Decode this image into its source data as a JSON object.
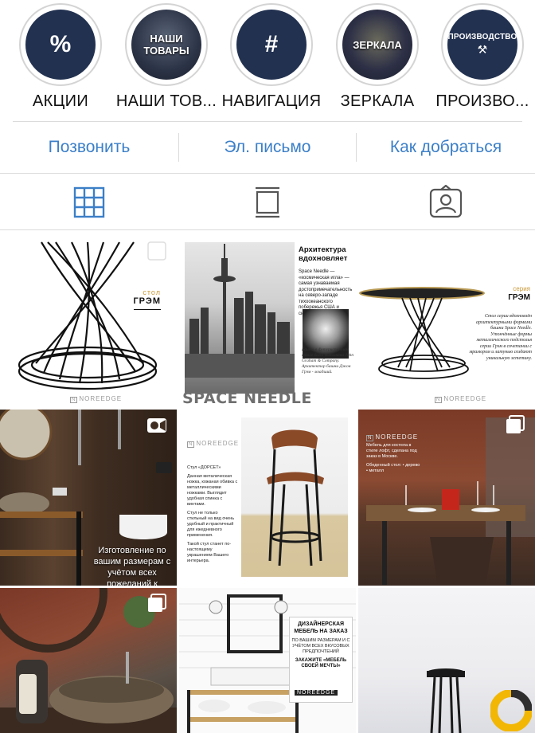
{
  "highlights": [
    {
      "label": "АКЦИИ",
      "symbol": "%"
    },
    {
      "label": "НАШИ ТОВ...",
      "cover_line1": "НАШИ",
      "cover_line2": "ТОВАРЫ"
    },
    {
      "label": "НАВИГАЦИЯ",
      "symbol": "#"
    },
    {
      "label": "ЗЕРКАЛА",
      "cover_text": "ЗЕРКАЛА"
    },
    {
      "label": "ПРОИЗВО...",
      "cover_text": "ПРОИЗВОДСТВО",
      "cover_icon": "hammer-crossed-icon"
    }
  ],
  "actions": {
    "call": "Позвонить",
    "email": "Эл. письмо",
    "directions": "Как добраться"
  },
  "tabs": {
    "grid_icon": "grid-icon",
    "feed_icon": "list-feed-icon",
    "tagged_icon": "tagged-person-icon",
    "active": "grid",
    "active_color": "#3b7fc8"
  },
  "posts": {
    "p1": {
      "small": "стол",
      "big": "ГРЭМ",
      "brand": "NOREEDGE",
      "multi": true
    },
    "p2": {
      "title": "SPACE NEEDLE",
      "heading_line1": "Архитектура",
      "heading_line2": "вдохновляет",
      "body": "Space Needle — «космическая игла» — самая узнаваемая достопримечательность на северо-западе тихоокеанского побережья США и символ города Сиэтл.",
      "caption": "Башня в футуристичном стиле была выполнена John Graham & Company. Архитектор башни Джон Грэм - младший."
    },
    "p3": {
      "small": "серия",
      "big": "ГРЭМ",
      "body": "Стол серии вдохновлён архитектурными формами башни Space Needle. Утончённые формы металлического подстолья серии Грэм в сочетании с мрамором и латунью создают уникальную эстетику.",
      "brand": "NOREEDGE"
    },
    "p4": {
      "caption": "Изготовление по вашим размерам с учётом всех пожеланий к материалам и дизайну",
      "video": true
    },
    "p5": {
      "brand": "NOREEDGE",
      "text1": "Стул «ДОРСЕТ»",
      "text2": "Данная металическая ножка, кожаная обивка с металлическими ножками. Выглядит удобная спинка с винтами.",
      "text3": "Стул не только стильный на вид очень удобный и практичный для ежедневного применения.",
      "text4": "Такой стул станет по-настоящему украшением Вашего интерьера."
    },
    "p6": {
      "brand": "NOREEDGE",
      "text1": "Мебель для костела в стиле лофт, сделана под заказ в Москве.",
      "text2": "Обеденный стол: • дерево • металл",
      "multi": true
    },
    "p7": {
      "multi": true
    },
    "p8": {
      "title": "ДИЗАЙНЕРСКАЯ МЕБЕЛЬ НА ЗАКАЗ",
      "sub": "ПО ВАШИМ РАЗМЕРАМ И С УЧЁТОМ ВСЕХ ВКУСОВЫХ ПРЕДПОЧТЕНИЙ",
      "order": "ЗАКАЖИТЕ «МЕБЕЛЬ СВОЕЙ МЕЧТЫ»",
      "brand": "NOREEDGE"
    },
    "p9": {
      "badge": "app-badge-icon"
    }
  }
}
